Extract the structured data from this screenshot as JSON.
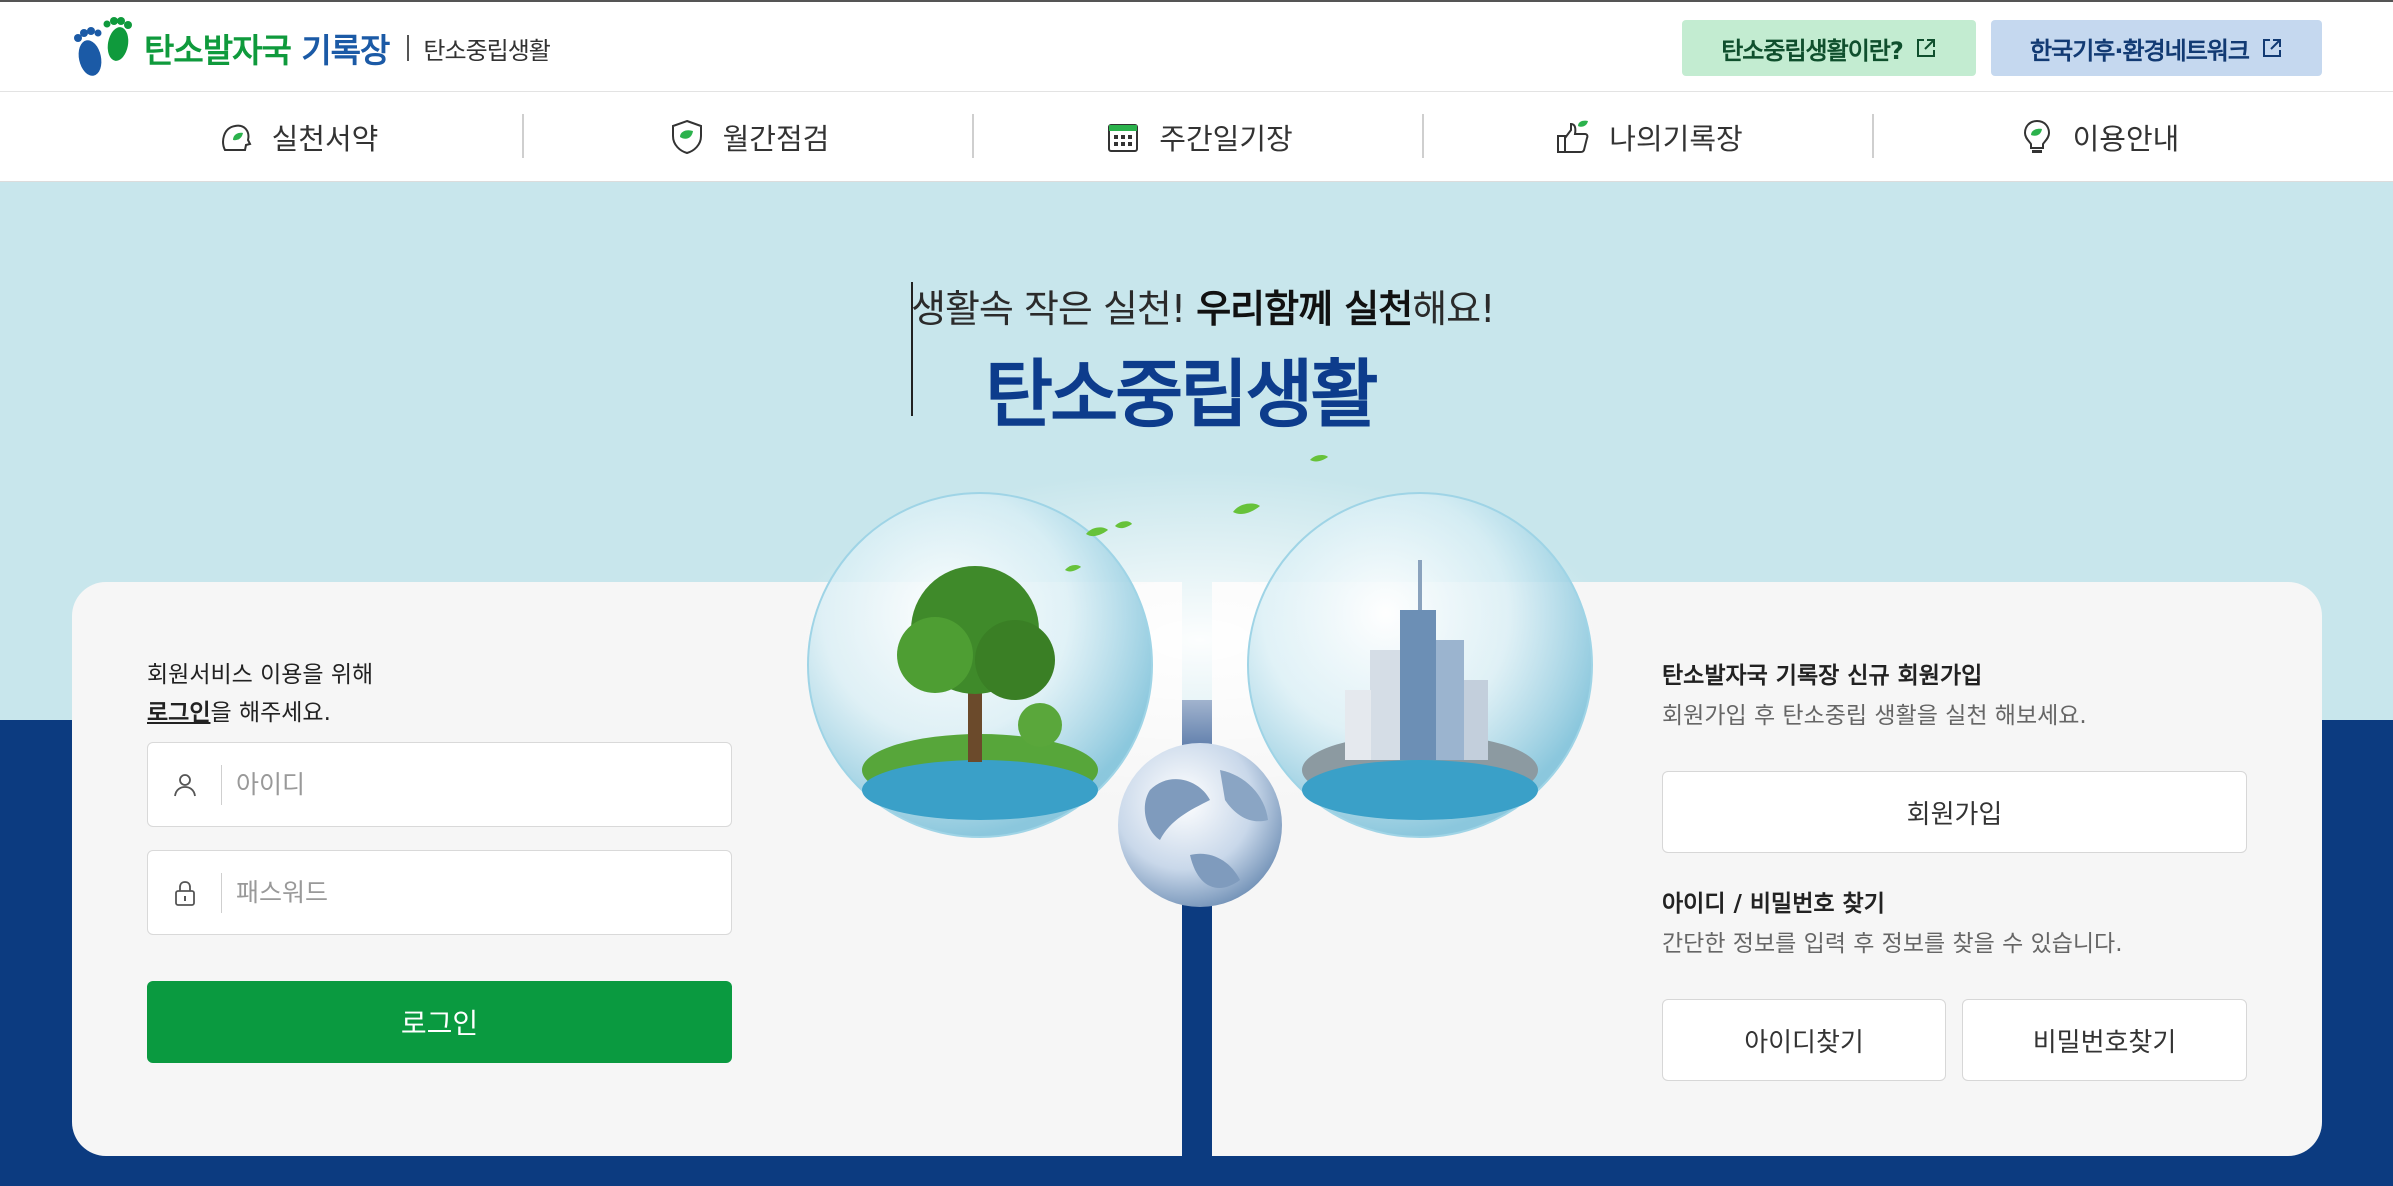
{
  "header": {
    "logo_main": "탄소발자국",
    "logo_accent": "기록장",
    "logo_sub": "탄소중립생활",
    "ext_links": [
      {
        "label": "탄소중립생활이란?"
      },
      {
        "label": "한국기후·환경네트워크"
      }
    ]
  },
  "nav": {
    "items": [
      {
        "label": "실천서약"
      },
      {
        "label": "월간점검"
      },
      {
        "label": "주간일기장"
      },
      {
        "label": "나의기록장"
      },
      {
        "label": "이용안내"
      }
    ]
  },
  "hero": {
    "slogan_pre": "생활속 작은 실천! ",
    "slogan_bold": "우리함께 실천",
    "slogan_post": "해요!",
    "title": "탄소중립생활"
  },
  "login": {
    "msg_line1": "회원서비스 이용을 위해",
    "msg_link": "로그인",
    "msg_line2_rest": "을 해주세요.",
    "id_placeholder": "아이디",
    "pw_placeholder": "패스워드",
    "submit_label": "로그인"
  },
  "join": {
    "heading": "탄소발자국 기록장 신규 회원가입",
    "desc": "회원가입 후 탄소중립 생활을 실천 해보세요.",
    "button_label": "회원가입"
  },
  "find": {
    "heading": "아이디 / 비밀번호 찾기",
    "desc": "간단한 정보를 입력 후 정보를 찾을 수 있습니다.",
    "find_id_label": "아이디찾기",
    "find_pw_label": "비밀번호찾기"
  },
  "colors": {
    "brand_green": "#0a9a40",
    "brand_blue": "#0d3c8c",
    "hero_sky": "#c8e6ec",
    "hero_navy": "#0c3b80"
  }
}
